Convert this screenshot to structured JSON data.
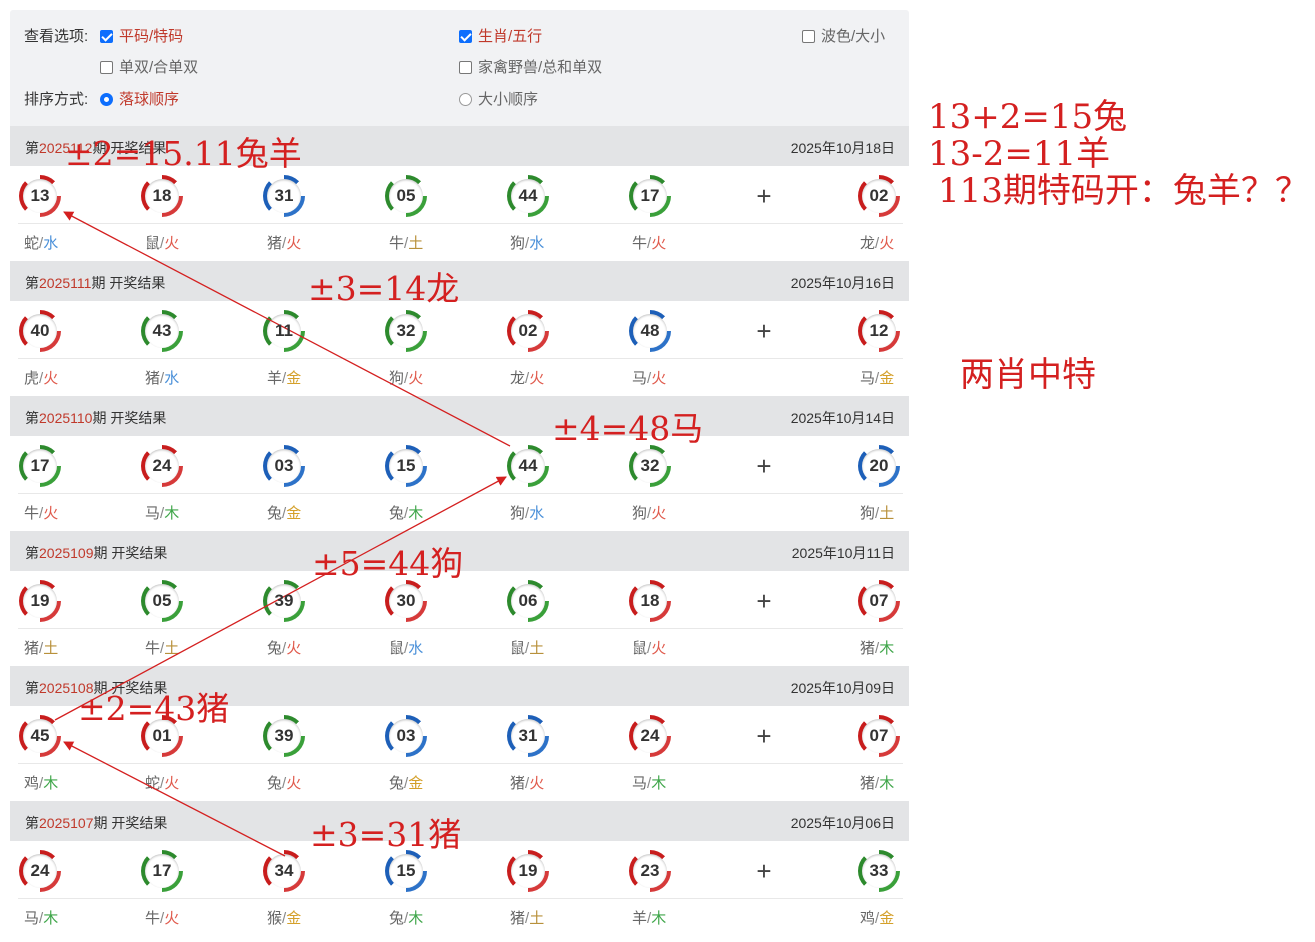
{
  "options": {
    "view_label": "查看选项:",
    "sort_label": "排序方式:",
    "checkboxes": [
      {
        "text": "平码/特码",
        "checked": true,
        "color": "red"
      },
      {
        "text": "生肖/五行",
        "checked": true,
        "color": "red"
      },
      {
        "text": "波色/大小",
        "checked": false,
        "color": "gray"
      },
      {
        "text": "单双/合单双",
        "checked": false,
        "color": "gray"
      },
      {
        "text": "家禽野兽/总和单双",
        "checked": false,
        "color": "gray"
      }
    ],
    "radios": [
      {
        "text": "落球顺序",
        "selected": true
      },
      {
        "text": "大小顺序",
        "selected": false
      }
    ]
  },
  "draws": [
    {
      "prefix": "第",
      "period": "2025112",
      "suffix": "期 开奖结果",
      "date": "2025年10月18日",
      "balls": [
        {
          "n": "13",
          "c": "red"
        },
        {
          "n": "18",
          "c": "red"
        },
        {
          "n": "31",
          "c": "blue"
        },
        {
          "n": "05",
          "c": "green"
        },
        {
          "n": "44",
          "c": "green"
        },
        {
          "n": "17",
          "c": "green"
        }
      ],
      "special": {
        "n": "02",
        "c": "red"
      },
      "labels": [
        {
          "z": "蛇",
          "e": "水"
        },
        {
          "z": "鼠",
          "e": "火"
        },
        {
          "z": "猪",
          "e": "火"
        },
        {
          "z": "牛",
          "e": "土"
        },
        {
          "z": "狗",
          "e": "水"
        },
        {
          "z": "牛",
          "e": "火"
        },
        {
          "z": "龙",
          "e": "火"
        }
      ]
    },
    {
      "prefix": "第",
      "period": "2025111",
      "suffix": "期 开奖结果",
      "date": "2025年10月16日",
      "balls": [
        {
          "n": "40",
          "c": "red"
        },
        {
          "n": "43",
          "c": "green"
        },
        {
          "n": "11",
          "c": "green"
        },
        {
          "n": "32",
          "c": "green"
        },
        {
          "n": "02",
          "c": "red"
        },
        {
          "n": "48",
          "c": "blue"
        }
      ],
      "special": {
        "n": "12",
        "c": "red"
      },
      "labels": [
        {
          "z": "虎",
          "e": "火"
        },
        {
          "z": "猪",
          "e": "水"
        },
        {
          "z": "羊",
          "e": "金"
        },
        {
          "z": "狗",
          "e": "火"
        },
        {
          "z": "龙",
          "e": "火"
        },
        {
          "z": "马",
          "e": "火"
        },
        {
          "z": "马",
          "e": "金"
        }
      ]
    },
    {
      "prefix": "第",
      "period": "2025110",
      "suffix": "期 开奖结果",
      "date": "2025年10月14日",
      "balls": [
        {
          "n": "17",
          "c": "green"
        },
        {
          "n": "24",
          "c": "red"
        },
        {
          "n": "03",
          "c": "blue"
        },
        {
          "n": "15",
          "c": "blue"
        },
        {
          "n": "44",
          "c": "green"
        },
        {
          "n": "32",
          "c": "green"
        }
      ],
      "special": {
        "n": "20",
        "c": "blue"
      },
      "labels": [
        {
          "z": "牛",
          "e": "火"
        },
        {
          "z": "马",
          "e": "木"
        },
        {
          "z": "兔",
          "e": "金"
        },
        {
          "z": "兔",
          "e": "木"
        },
        {
          "z": "狗",
          "e": "水"
        },
        {
          "z": "狗",
          "e": "火"
        },
        {
          "z": "狗",
          "e": "土"
        }
      ]
    },
    {
      "prefix": "第",
      "period": "2025109",
      "suffix": "期 开奖结果",
      "date": "2025年10月11日",
      "balls": [
        {
          "n": "19",
          "c": "red"
        },
        {
          "n": "05",
          "c": "green"
        },
        {
          "n": "39",
          "c": "green"
        },
        {
          "n": "30",
          "c": "red"
        },
        {
          "n": "06",
          "c": "green"
        },
        {
          "n": "18",
          "c": "red"
        }
      ],
      "special": {
        "n": "07",
        "c": "red"
      },
      "labels": [
        {
          "z": "猪",
          "e": "土"
        },
        {
          "z": "牛",
          "e": "土"
        },
        {
          "z": "兔",
          "e": "火"
        },
        {
          "z": "鼠",
          "e": "水"
        },
        {
          "z": "鼠",
          "e": "土"
        },
        {
          "z": "鼠",
          "e": "火"
        },
        {
          "z": "猪",
          "e": "木"
        }
      ]
    },
    {
      "prefix": "第",
      "period": "2025108",
      "suffix": "期 开奖结果",
      "date": "2025年10月09日",
      "balls": [
        {
          "n": "45",
          "c": "red"
        },
        {
          "n": "01",
          "c": "red"
        },
        {
          "n": "39",
          "c": "green"
        },
        {
          "n": "03",
          "c": "blue"
        },
        {
          "n": "31",
          "c": "blue"
        },
        {
          "n": "24",
          "c": "red"
        }
      ],
      "special": {
        "n": "07",
        "c": "red"
      },
      "labels": [
        {
          "z": "鸡",
          "e": "木"
        },
        {
          "z": "蛇",
          "e": "火"
        },
        {
          "z": "兔",
          "e": "火"
        },
        {
          "z": "兔",
          "e": "金"
        },
        {
          "z": "猪",
          "e": "火"
        },
        {
          "z": "马",
          "e": "木"
        },
        {
          "z": "猪",
          "e": "木"
        }
      ]
    },
    {
      "prefix": "第",
      "period": "2025107",
      "suffix": "期 开奖结果",
      "date": "2025年10月06日",
      "balls": [
        {
          "n": "24",
          "c": "red"
        },
        {
          "n": "17",
          "c": "green"
        },
        {
          "n": "34",
          "c": "red"
        },
        {
          "n": "15",
          "c": "blue"
        },
        {
          "n": "19",
          "c": "red"
        },
        {
          "n": "23",
          "c": "red"
        }
      ],
      "special": {
        "n": "33",
        "c": "green"
      },
      "labels": [
        {
          "z": "马",
          "e": "木"
        },
        {
          "z": "牛",
          "e": "火"
        },
        {
          "z": "猴",
          "e": "金"
        },
        {
          "z": "兔",
          "e": "木"
        },
        {
          "z": "猪",
          "e": "土"
        },
        {
          "z": "羊",
          "e": "木"
        },
        {
          "z": "鸡",
          "e": "金"
        }
      ]
    }
  ],
  "plus_sign": "+",
  "label_separator": "/",
  "element_colors": {
    "火": "#e05a4c",
    "水": "#4a90d9",
    "木": "#3fa64a",
    "金": "#d4a02a",
    "土": "#b8913b"
  },
  "annotations": {
    "a1": "±2=15.11兔羊",
    "a2": "±3=14龙",
    "a3": "±4=48马",
    "a4": "±5=44狗",
    "a5": "±2=43猪",
    "a6": "±3=31猪",
    "r1": "13+2=15兔",
    "r2": "13-2=11羊",
    "r3": "113期特码开：兔羊？？",
    "r4": "两肖中特"
  }
}
